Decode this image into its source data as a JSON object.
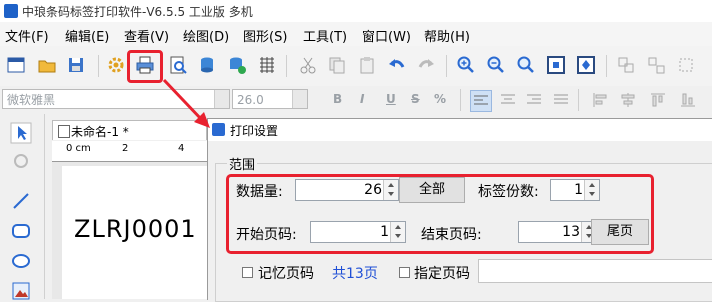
{
  "app": {
    "title": "中琅条码标签打印软件-V6.5.5 工业版 多机"
  },
  "menu": [
    {
      "label": "文件(F)"
    },
    {
      "label": "编辑(E)"
    },
    {
      "label": "查看(V)"
    },
    {
      "label": "绘图(D)"
    },
    {
      "label": "图形(S)"
    },
    {
      "label": "工具(T)"
    },
    {
      "label": "窗口(W)"
    },
    {
      "label": "帮助(H)"
    }
  ],
  "format_bar": {
    "font_name": "微软雅黑",
    "font_size": "26.0",
    "bold": "B",
    "italic": "I",
    "underline": "U",
    "strike": "S",
    "scale": "%"
  },
  "document": {
    "tab_label": "未命名-1 *",
    "ruler": [
      "0 cm",
      "2",
      "4"
    ],
    "barcode_text": "ZLRJ0001"
  },
  "print_dialog": {
    "title": "打印设置",
    "group_title": "范围",
    "data_count_label": "数据量:",
    "data_count_value": "26",
    "all_button": "全部",
    "copies_label": "标签份数:",
    "copies_value": "1",
    "start_page_label": "开始页码:",
    "start_page_value": "1",
    "end_page_label": "结束页码:",
    "end_page_value": "13",
    "last_page_button": "尾页",
    "remember_page_label": "记忆页码",
    "total_pages": "共13页",
    "specify_page_label": "指定页码"
  },
  "colors": {
    "highlight": "#e8212f",
    "total_pages": "#1f4fd6"
  }
}
